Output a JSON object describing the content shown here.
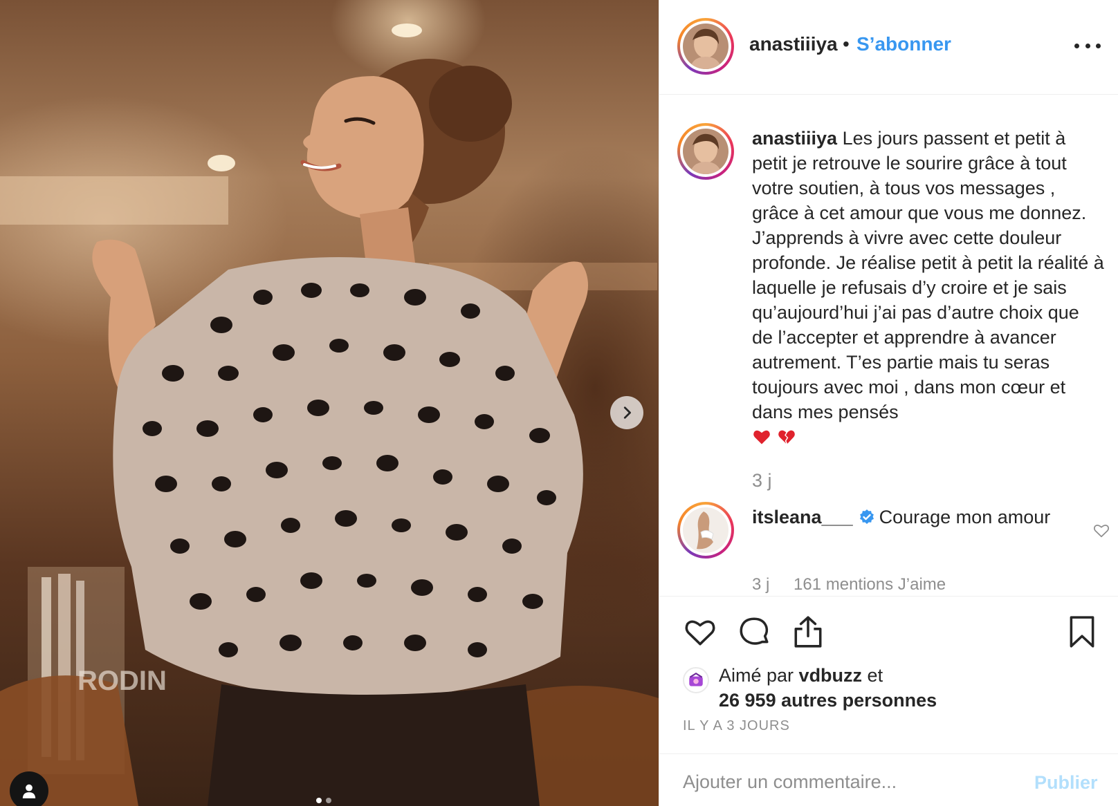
{
  "post": {
    "username": "anastiiiya",
    "separator": "•",
    "follow_label": "S’abonner",
    "more_icon": "more-horizontal-icon"
  },
  "photo": {
    "description_icon": "photo",
    "carousel_next_icon": "chevron-right-icon",
    "tag_icon": "user-tag-icon",
    "slide_count": 2,
    "active_slide": 1,
    "sign_text": "RODIN"
  },
  "caption": {
    "username": "anastiiiya",
    "text": " Les jours passent et petit à petit je retrouve le sourire grâce à tout votre soutien, à tous vos messages , grâce à cet amour que vous me donnez. J’apprends à vivre avec cette douleur profonde. Je réalise petit à petit la réalité à laquelle je refusais d’y croire et je sais qu’aujourd’hui j’ai pas d’autre choix que de l’accepter et apprendre à avancer autrement. T’es partie mais tu seras toujours avec moi , dans mon cœur et dans mes pensés",
    "emojis": [
      "red-heart",
      "broken-heart"
    ],
    "time": "3 j"
  },
  "comment": {
    "username": "itsleana___",
    "verified": true,
    "text": "Courage mon amour",
    "time": "3 j",
    "likes": "161 mentions J’aime",
    "like_icon": "heart-outline-icon"
  },
  "actions": {
    "like_icon": "heart-icon",
    "comment_icon": "comment-icon",
    "share_icon": "share-icon",
    "save_icon": "bookmark-icon"
  },
  "likes": {
    "prefix": "Aimé par ",
    "user": "vdbuzz",
    "middle": " et",
    "count": "26 959 autres personnes"
  },
  "date": "IL Y A 3 JOURS",
  "add_comment": {
    "placeholder": "Ajouter un commentaire...",
    "publish_label": "Publier"
  },
  "colors": {
    "accent": "#3897f0",
    "publish_disabled": "#b2dffc",
    "muted": "#8e8e8e",
    "text": "#262626"
  }
}
